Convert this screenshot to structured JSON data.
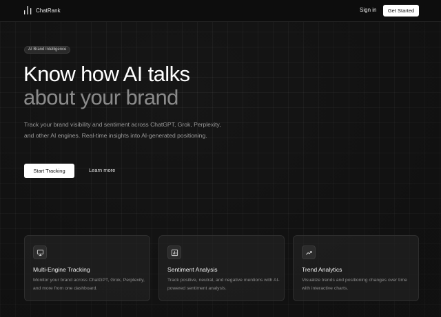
{
  "header": {
    "brand_name": "ChatRank",
    "brand_icon": "bar-chart-icon",
    "signin_label": "Sign in",
    "get_started_label": "Get Started"
  },
  "hero": {
    "badge": "AI Brand Intelligence",
    "title_line1": "Know how AI talks",
    "title_line2": "about your brand",
    "subtitle": "Track your brand visibility and sentiment across ChatGPT, Grok, Perplexity, and other AI engines. Real-time insights into AI-generated positioning.",
    "primary_cta": "Start Tracking",
    "secondary_cta": "Learn more"
  },
  "features": [
    {
      "icon": "monitor-icon",
      "title": "Multi-Engine Tracking",
      "description": "Monitor your brand across ChatGPT, Grok, Perplexity, and more from one dashboard."
    },
    {
      "icon": "bar-chart-icon",
      "title": "Sentiment Analysis",
      "description": "Track positive, neutral, and negative mentions with AI-powered sentiment analysis."
    },
    {
      "icon": "trend-up-icon",
      "title": "Trend Analytics",
      "description": "Visualize trends and positioning changes over time with interactive charts."
    }
  ],
  "colors": {
    "background": "#161616",
    "header": "#0d0d0d",
    "text_primary": "#ffffff",
    "text_muted": "#8a8a8a",
    "button": "#ffffff"
  }
}
